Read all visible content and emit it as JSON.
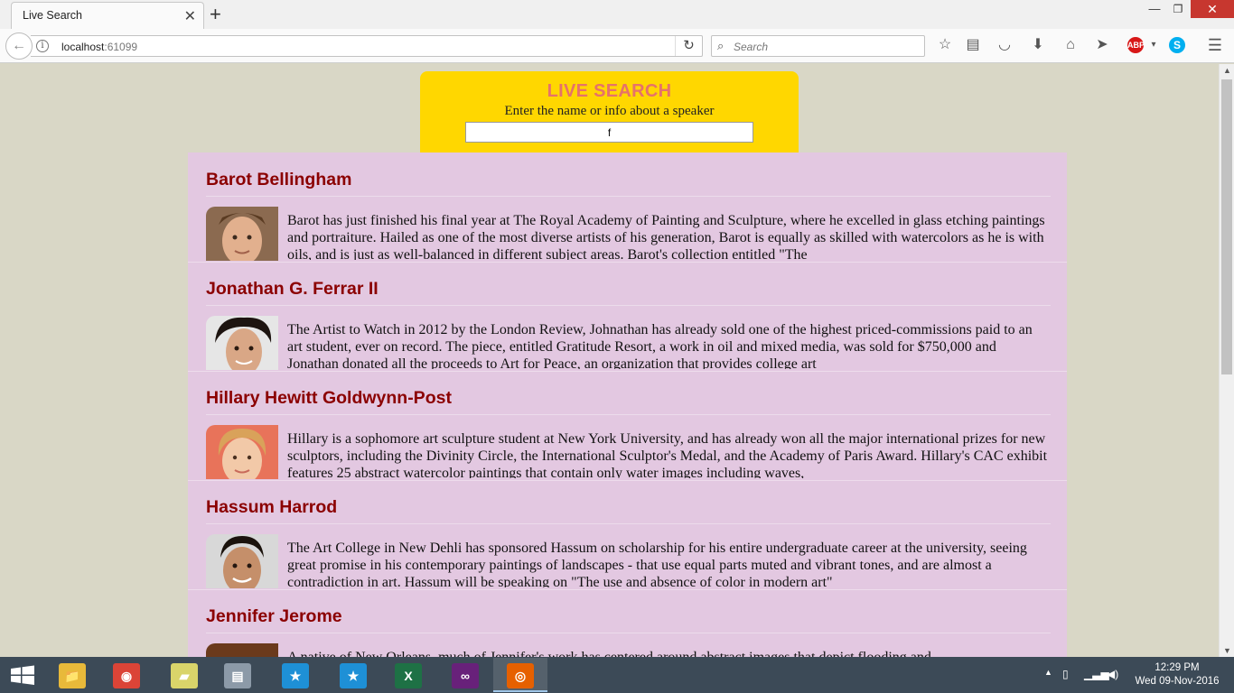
{
  "browser": {
    "tab_title": "Live Search",
    "tab_close": "✕",
    "new_tab": "+",
    "url_host": "localhost",
    "url_port": ":61099",
    "search_placeholder": "Search",
    "window_controls": {
      "minimize": "—",
      "maximize": "❐",
      "close": "✕"
    },
    "toolbar_icons": [
      "star-icon",
      "reading-list-icon",
      "pocket-icon",
      "download-icon",
      "home-icon",
      "send-icon",
      "adblock-icon",
      "skype-icon",
      "menu-icon"
    ]
  },
  "page": {
    "title": "LIVE SEARCH",
    "subtitle": "Enter the name or info about a speaker",
    "search_value": "f",
    "speakers": [
      {
        "name": "Barot Bellingham",
        "bio": "Barot has just finished his final year at The Royal Academy of Painting and Sculpture, where he excelled in glass etching paintings and portraiture. Hailed as one of the most diverse artists of his generation, Barot is equally as skilled with watercolors as he is with oils, and is just as well-balanced in different subject areas. Barot's collection entitled \"The"
      },
      {
        "name": "Jonathan G. Ferrar II",
        "bio": "The Artist to Watch in 2012 by the London Review, Johnathan has already sold one of the highest priced-commissions paid to an art student, ever on record. The piece, entitled Gratitude Resort, a work in oil and mixed media, was sold for $750,000 and Jonathan donated all the proceeds to Art for Peace, an organization that provides college art"
      },
      {
        "name": "Hillary Hewitt Goldwynn-Post",
        "bio": "Hillary is a sophomore art sculpture student at New York University, and has already won all the major international prizes for new sculptors, including the Divinity Circle, the International Sculptor's Medal, and the Academy of Paris Award. Hillary's CAC exhibit features 25 abstract watercolor paintings that contain only water images including waves,"
      },
      {
        "name": "Hassum Harrod",
        "bio": "The Art College in New Dehli has sponsored Hassum on scholarship for his entire undergraduate career at the university, seeing great promise in his contemporary paintings of landscapes - that use equal parts muted and vibrant tones, and are almost a contradiction in art. Hassum will be speaking on \"The use and absence of color in modern art\""
      },
      {
        "name": "Jennifer Jerome",
        "bio": "A native of New Orleans, much of Jennifer's work has centered around abstract images that depict flooding and"
      }
    ]
  },
  "taskbar": {
    "apps": [
      {
        "name": "file-explorer",
        "glyph": "📁",
        "color": "#e8b93a"
      },
      {
        "name": "chrome",
        "glyph": "◉",
        "color": "#db4437"
      },
      {
        "name": "sticky-notes",
        "glyph": "▰",
        "color": "#d9d46a"
      },
      {
        "name": "archive",
        "glyph": "▤",
        "color": "#8c9aa8"
      },
      {
        "name": "app-star-1",
        "glyph": "★",
        "color": "#1e90d6"
      },
      {
        "name": "app-star-2",
        "glyph": "★",
        "color": "#1e90d6"
      },
      {
        "name": "excel",
        "glyph": "X",
        "color": "#1e7145"
      },
      {
        "name": "visual-studio",
        "glyph": "∞",
        "color": "#68217a"
      },
      {
        "name": "firefox",
        "glyph": "◎",
        "color": "#e66000"
      }
    ],
    "time": "12:29 PM",
    "date": "Wed 09-Nov-2016"
  }
}
